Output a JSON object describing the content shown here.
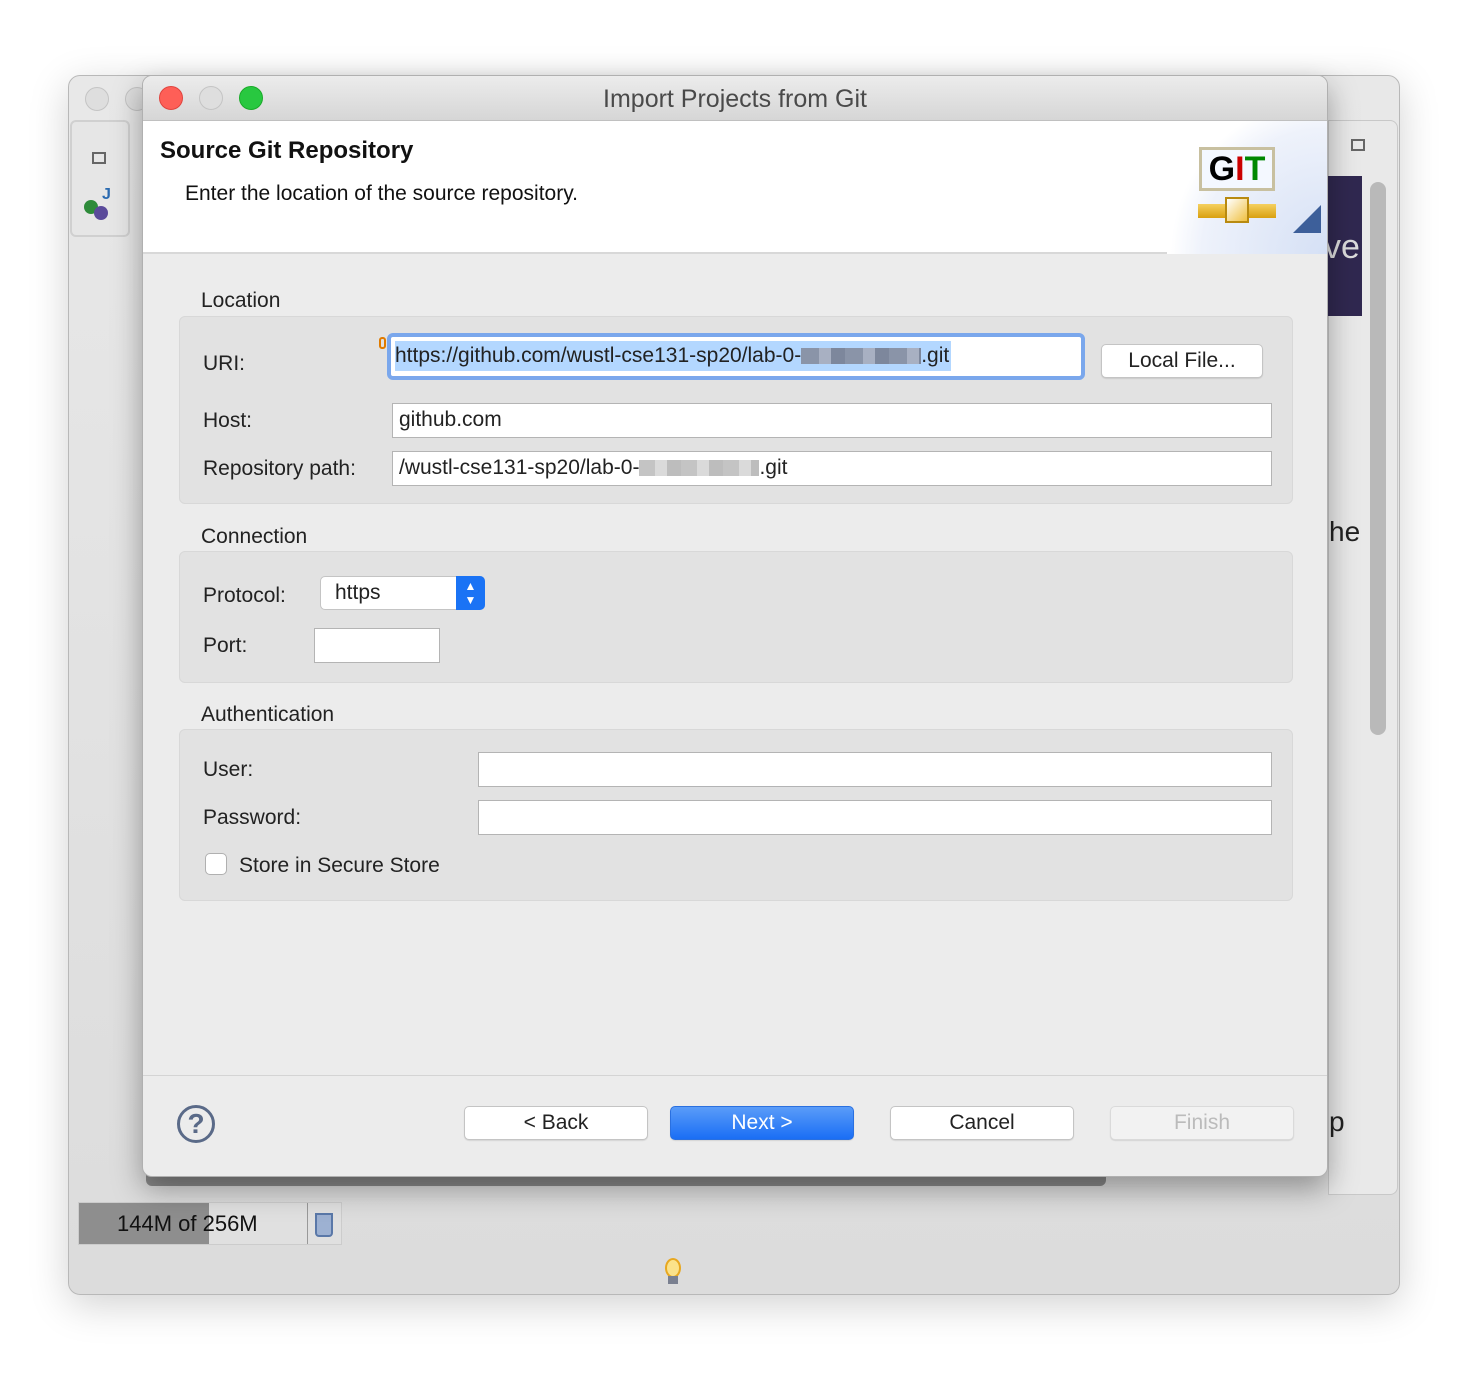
{
  "window": {
    "title": "Import Projects from Git"
  },
  "background": {
    "text_fragments": [
      "ve",
      "he",
      "p"
    ],
    "memory": {
      "used": "144M",
      "total": "256M",
      "label": "144M of 256M",
      "used_fraction": 0.5625
    }
  },
  "header": {
    "title": "Source Git Repository",
    "description": "Enter the location of the source repository.",
    "logo_text": [
      "G",
      "I",
      "T"
    ]
  },
  "location": {
    "label": "Location",
    "uri_label": "URI:",
    "uri_prefix": "https://github.com/wustl-cse131-sp20/lab-0-",
    "uri_suffix": ".git",
    "local_file_button": "Local File...",
    "host_label": "Host:",
    "host_value": "github.com",
    "path_label": "Repository path:",
    "path_prefix": "/wustl-cse131-sp20/lab-0-",
    "path_suffix": ".git"
  },
  "connection": {
    "label": "Connection",
    "protocol_label": "Protocol:",
    "protocol_value": "https",
    "port_label": "Port:",
    "port_value": ""
  },
  "authentication": {
    "label": "Authentication",
    "user_label": "User:",
    "user_value": "",
    "password_label": "Password:",
    "password_value": "",
    "store_label": "Store in Secure Store",
    "store_checked": false
  },
  "footer": {
    "back": "< Back",
    "next": "Next >",
    "cancel": "Cancel",
    "finish": "Finish"
  },
  "colors": {
    "accent": "#1a73f5",
    "selection": "#b3d7ff",
    "close": "#fe5f57",
    "zoom": "#28c840"
  }
}
